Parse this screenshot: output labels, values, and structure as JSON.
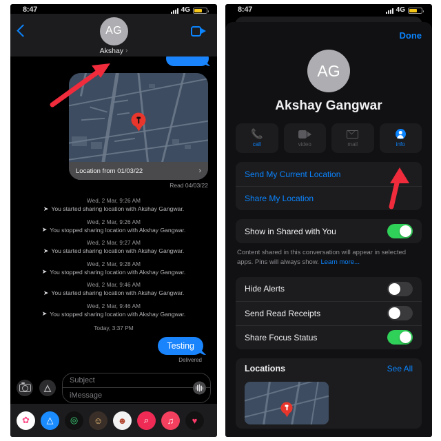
{
  "status_bar": {
    "time": "8:47",
    "network": "4G",
    "signal_icon": "signal-bars-icon",
    "battery_icon": "battery-icon",
    "battery_color": "#f5c518"
  },
  "colors": {
    "accent_blue": "#0a84ff",
    "bubble_blue": "#1a84fc",
    "toggle_green": "#30d158",
    "map_bg": "#3d4c60",
    "pin_red": "#e8362c",
    "annotation_red": "#ef2b3c"
  },
  "left_panel": {
    "header": {
      "back_icon": "back-chevron-icon",
      "avatar_initials": "AG",
      "contact_name": "Akshay",
      "disclosure_icon": "chevron-right-icon",
      "facetime_icon": "video-camera-icon"
    },
    "map_message": {
      "caption": "Location from 01/03/22",
      "disclosure_icon": "chevron-right-icon",
      "pin_icon": "map-pin-icon",
      "read_receipt": "Read 04/03/22"
    },
    "timeline": [
      {
        "time": "Wed, 2 Mar, 9:26 AM",
        "text": "You started sharing location with Akshay  Gangwar."
      },
      {
        "time": "Wed, 2 Mar, 9:26 AM",
        "text": "You stopped sharing location with Akshay  Gangwar."
      },
      {
        "time": "Wed, 2 Mar, 9:27 AM",
        "text": "You started sharing location with Akshay  Gangwar."
      },
      {
        "time": "Wed, 2 Mar, 9:28 AM",
        "text": "You stopped sharing location with Akshay  Gangwar."
      },
      {
        "time": "Wed, 2 Mar, 9:46 AM",
        "text": "You started sharing location with Akshay  Gangwar."
      },
      {
        "time": "Wed, 2 Mar, 9:46 AM",
        "text": "You stopped sharing location with Akshay  Gangwar."
      }
    ],
    "today_separator": "Today, 3:37 PM",
    "sent_message": {
      "text": "Testing",
      "status": "Delivered"
    },
    "input_bar": {
      "camera_icon": "camera-icon",
      "apps_icon": "app-store-icon",
      "subject_placeholder": "Subject",
      "message_placeholder": "iMessage",
      "audio_icon": "audio-waveform-icon"
    },
    "app_drawer": [
      {
        "name": "photos-app-icon",
        "glyph": "✿",
        "bg": "#ffffff",
        "fg": "#ff4f8b"
      },
      {
        "name": "app-store-app-icon",
        "glyph": "A",
        "bg": "#1a8cff",
        "fg": "#ffffff"
      },
      {
        "name": "fitness-app-icon",
        "glyph": "◎",
        "bg": "#111111",
        "fg": "#3ee07f"
      },
      {
        "name": "memoji-app-icon",
        "glyph": "☺",
        "bg": "#3a2f28",
        "fg": "#f0c27a"
      },
      {
        "name": "memoji-2-app-icon",
        "glyph": "☻",
        "bg": "#f2f2f2",
        "fg": "#b2452e"
      },
      {
        "name": "image-search-icon",
        "glyph": "⌕",
        "bg": "#ef2b55",
        "fg": "#ffffff"
      },
      {
        "name": "music-app-icon",
        "glyph": "♫",
        "bg": "#f43f5e",
        "fg": "#ffffff"
      },
      {
        "name": "digital-touch-icon",
        "glyph": "♥",
        "bg": "#121212",
        "fg": "#ff3b6b"
      }
    ]
  },
  "right_panel": {
    "done_label": "Done",
    "avatar_initials": "AG",
    "contact_name": "Akshay  Gangwar",
    "actions": [
      {
        "label": "call",
        "icon": "phone-icon",
        "enabled": true
      },
      {
        "label": "video",
        "icon": "video-camera-icon",
        "enabled": false
      },
      {
        "label": "mail",
        "icon": "envelope-icon",
        "enabled": false
      },
      {
        "label": "info",
        "icon": "person-circle-icon",
        "enabled": true
      }
    ],
    "location_links": [
      "Send My Current Location",
      "Share My Location"
    ],
    "shared_with_you": {
      "label": "Show in Shared with You",
      "toggle_on": true,
      "footer_text": "Content shared in this conversation will appear in selected apps. Pins will always show. ",
      "footer_link": "Learn more..."
    },
    "settings": [
      {
        "label": "Hide Alerts",
        "toggle_on": false
      },
      {
        "label": "Send Read Receipts",
        "toggle_on": false
      },
      {
        "label": "Share Focus Status",
        "toggle_on": true
      }
    ],
    "locations_section": {
      "title": "Locations",
      "see_all": "See All",
      "thumb_pin_icon": "map-pin-icon"
    }
  },
  "annotations": [
    {
      "name": "arrow-to-contact-name",
      "target": "Akshay contact name in header"
    },
    {
      "name": "arrow-to-info-button",
      "target": "info action button"
    }
  ]
}
